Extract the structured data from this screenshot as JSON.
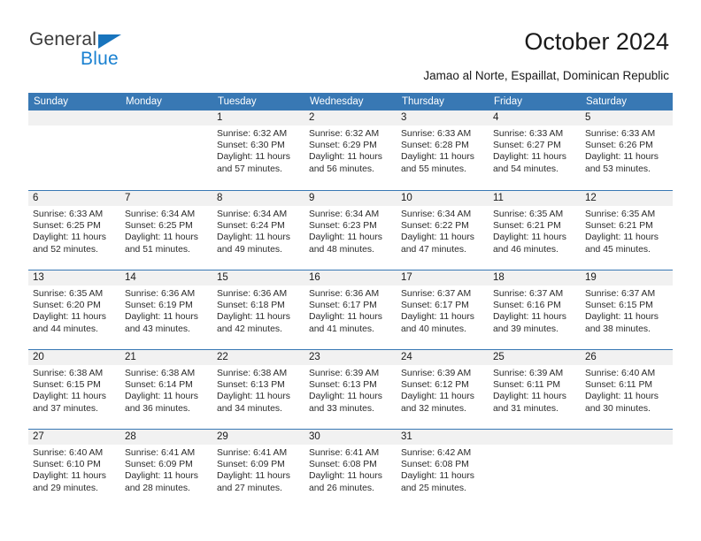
{
  "brand": {
    "name_part1": "General",
    "name_part2": "Blue",
    "triangle_icon": "triangle-icon",
    "accent_color": "#1a81d1"
  },
  "header": {
    "title": "October 2024",
    "subtitle": "Jamao al Norte, Espaillat, Dominican Republic"
  },
  "calendar": {
    "header_color": "#3878b4",
    "daynum_band_color": "#f1f1f1",
    "weekday_headers": [
      "Sunday",
      "Monday",
      "Tuesday",
      "Wednesday",
      "Thursday",
      "Friday",
      "Saturday"
    ],
    "weeks": [
      [
        {
          "day": "",
          "empty": true,
          "sunrise": "",
          "sunset": "",
          "daylight": ""
        },
        {
          "day": "",
          "empty": true,
          "sunrise": "",
          "sunset": "",
          "daylight": ""
        },
        {
          "day": "1",
          "sunrise": "Sunrise: 6:32 AM",
          "sunset": "Sunset: 6:30 PM",
          "daylight": "Daylight: 11 hours and 57 minutes."
        },
        {
          "day": "2",
          "sunrise": "Sunrise: 6:32 AM",
          "sunset": "Sunset: 6:29 PM",
          "daylight": "Daylight: 11 hours and 56 minutes."
        },
        {
          "day": "3",
          "sunrise": "Sunrise: 6:33 AM",
          "sunset": "Sunset: 6:28 PM",
          "daylight": "Daylight: 11 hours and 55 minutes."
        },
        {
          "day": "4",
          "sunrise": "Sunrise: 6:33 AM",
          "sunset": "Sunset: 6:27 PM",
          "daylight": "Daylight: 11 hours and 54 minutes."
        },
        {
          "day": "5",
          "sunrise": "Sunrise: 6:33 AM",
          "sunset": "Sunset: 6:26 PM",
          "daylight": "Daylight: 11 hours and 53 minutes."
        }
      ],
      [
        {
          "day": "6",
          "sunrise": "Sunrise: 6:33 AM",
          "sunset": "Sunset: 6:25 PM",
          "daylight": "Daylight: 11 hours and 52 minutes."
        },
        {
          "day": "7",
          "sunrise": "Sunrise: 6:34 AM",
          "sunset": "Sunset: 6:25 PM",
          "daylight": "Daylight: 11 hours and 51 minutes."
        },
        {
          "day": "8",
          "sunrise": "Sunrise: 6:34 AM",
          "sunset": "Sunset: 6:24 PM",
          "daylight": "Daylight: 11 hours and 49 minutes."
        },
        {
          "day": "9",
          "sunrise": "Sunrise: 6:34 AM",
          "sunset": "Sunset: 6:23 PM",
          "daylight": "Daylight: 11 hours and 48 minutes."
        },
        {
          "day": "10",
          "sunrise": "Sunrise: 6:34 AM",
          "sunset": "Sunset: 6:22 PM",
          "daylight": "Daylight: 11 hours and 47 minutes."
        },
        {
          "day": "11",
          "sunrise": "Sunrise: 6:35 AM",
          "sunset": "Sunset: 6:21 PM",
          "daylight": "Daylight: 11 hours and 46 minutes."
        },
        {
          "day": "12",
          "sunrise": "Sunrise: 6:35 AM",
          "sunset": "Sunset: 6:21 PM",
          "daylight": "Daylight: 11 hours and 45 minutes."
        }
      ],
      [
        {
          "day": "13",
          "sunrise": "Sunrise: 6:35 AM",
          "sunset": "Sunset: 6:20 PM",
          "daylight": "Daylight: 11 hours and 44 minutes."
        },
        {
          "day": "14",
          "sunrise": "Sunrise: 6:36 AM",
          "sunset": "Sunset: 6:19 PM",
          "daylight": "Daylight: 11 hours and 43 minutes."
        },
        {
          "day": "15",
          "sunrise": "Sunrise: 6:36 AM",
          "sunset": "Sunset: 6:18 PM",
          "daylight": "Daylight: 11 hours and 42 minutes."
        },
        {
          "day": "16",
          "sunrise": "Sunrise: 6:36 AM",
          "sunset": "Sunset: 6:17 PM",
          "daylight": "Daylight: 11 hours and 41 minutes."
        },
        {
          "day": "17",
          "sunrise": "Sunrise: 6:37 AM",
          "sunset": "Sunset: 6:17 PM",
          "daylight": "Daylight: 11 hours and 40 minutes."
        },
        {
          "day": "18",
          "sunrise": "Sunrise: 6:37 AM",
          "sunset": "Sunset: 6:16 PM",
          "daylight": "Daylight: 11 hours and 39 minutes."
        },
        {
          "day": "19",
          "sunrise": "Sunrise: 6:37 AM",
          "sunset": "Sunset: 6:15 PM",
          "daylight": "Daylight: 11 hours and 38 minutes."
        }
      ],
      [
        {
          "day": "20",
          "sunrise": "Sunrise: 6:38 AM",
          "sunset": "Sunset: 6:15 PM",
          "daylight": "Daylight: 11 hours and 37 minutes."
        },
        {
          "day": "21",
          "sunrise": "Sunrise: 6:38 AM",
          "sunset": "Sunset: 6:14 PM",
          "daylight": "Daylight: 11 hours and 36 minutes."
        },
        {
          "day": "22",
          "sunrise": "Sunrise: 6:38 AM",
          "sunset": "Sunset: 6:13 PM",
          "daylight": "Daylight: 11 hours and 34 minutes."
        },
        {
          "day": "23",
          "sunrise": "Sunrise: 6:39 AM",
          "sunset": "Sunset: 6:13 PM",
          "daylight": "Daylight: 11 hours and 33 minutes."
        },
        {
          "day": "24",
          "sunrise": "Sunrise: 6:39 AM",
          "sunset": "Sunset: 6:12 PM",
          "daylight": "Daylight: 11 hours and 32 minutes."
        },
        {
          "day": "25",
          "sunrise": "Sunrise: 6:39 AM",
          "sunset": "Sunset: 6:11 PM",
          "daylight": "Daylight: 11 hours and 31 minutes."
        },
        {
          "day": "26",
          "sunrise": "Sunrise: 6:40 AM",
          "sunset": "Sunset: 6:11 PM",
          "daylight": "Daylight: 11 hours and 30 minutes."
        }
      ],
      [
        {
          "day": "27",
          "sunrise": "Sunrise: 6:40 AM",
          "sunset": "Sunset: 6:10 PM",
          "daylight": "Daylight: 11 hours and 29 minutes."
        },
        {
          "day": "28",
          "sunrise": "Sunrise: 6:41 AM",
          "sunset": "Sunset: 6:09 PM",
          "daylight": "Daylight: 11 hours and 28 minutes."
        },
        {
          "day": "29",
          "sunrise": "Sunrise: 6:41 AM",
          "sunset": "Sunset: 6:09 PM",
          "daylight": "Daylight: 11 hours and 27 minutes."
        },
        {
          "day": "30",
          "sunrise": "Sunrise: 6:41 AM",
          "sunset": "Sunset: 6:08 PM",
          "daylight": "Daylight: 11 hours and 26 minutes."
        },
        {
          "day": "31",
          "sunrise": "Sunrise: 6:42 AM",
          "sunset": "Sunset: 6:08 PM",
          "daylight": "Daylight: 11 hours and 25 minutes."
        },
        {
          "day": "",
          "empty": true,
          "sunrise": "",
          "sunset": "",
          "daylight": ""
        },
        {
          "day": "",
          "empty": true,
          "sunrise": "",
          "sunset": "",
          "daylight": ""
        }
      ]
    ]
  }
}
